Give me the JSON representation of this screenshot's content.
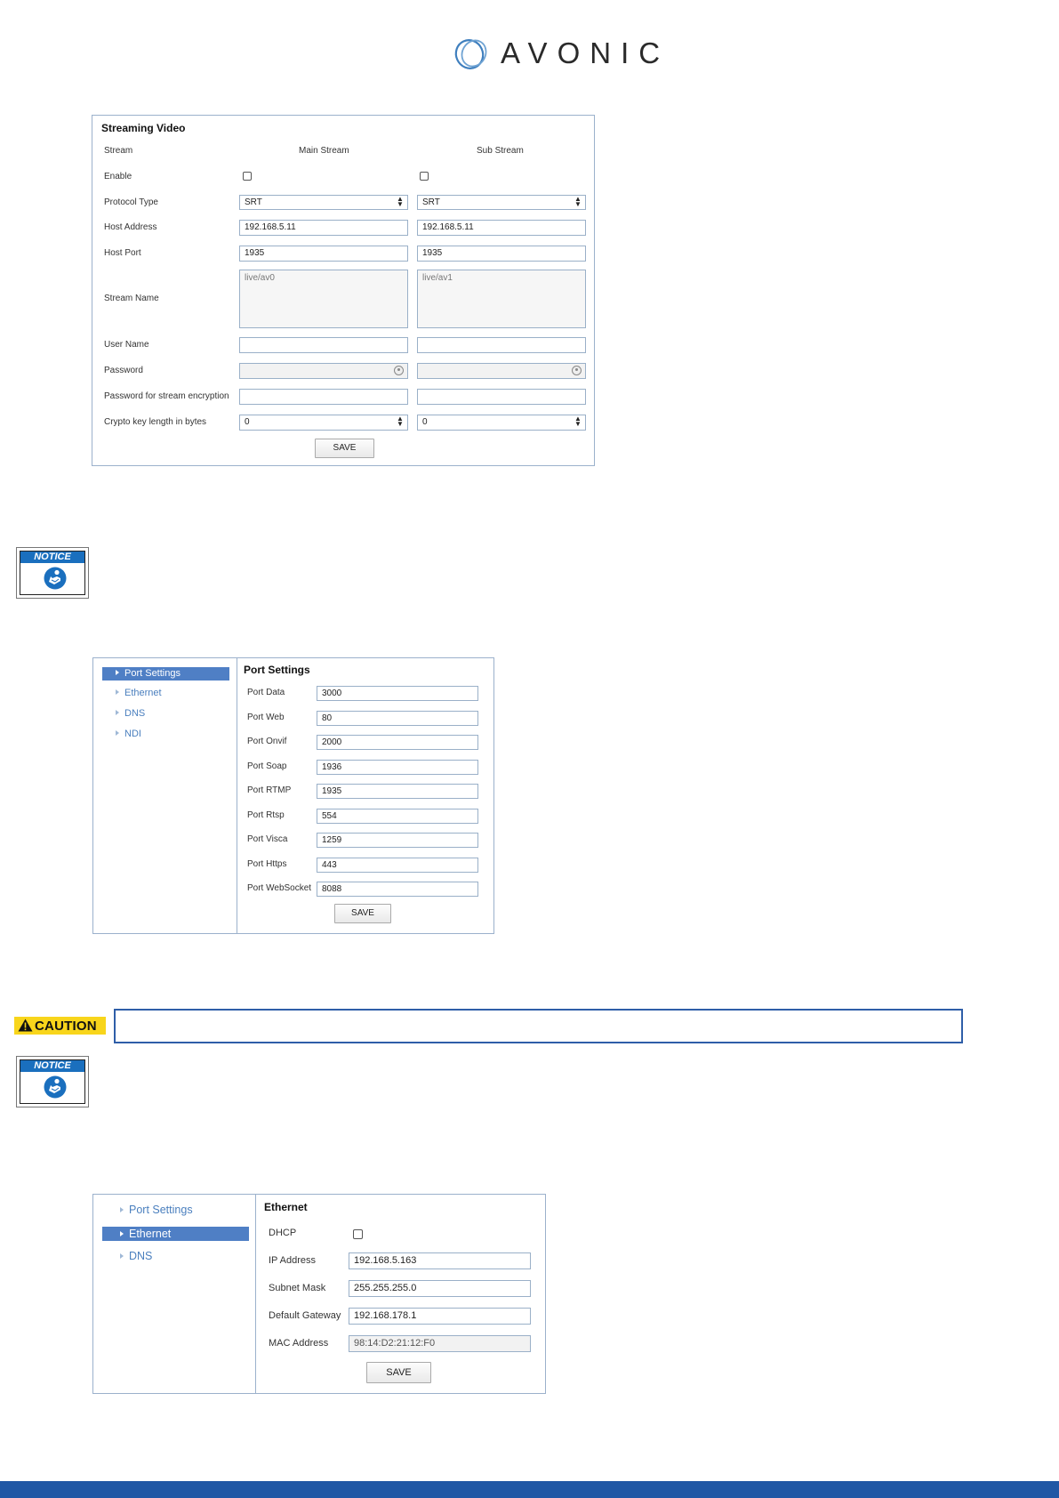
{
  "brand": {
    "name": "AVONIC",
    "color": "#2a2a2a",
    "accent": "#4a8ac5"
  },
  "streaming": {
    "title": "Streaming Video",
    "col_stream": "Stream",
    "col_main": "Main Stream",
    "col_sub": "Sub Stream",
    "enable_label": "Enable",
    "protocol_label": "Protocol Type",
    "host_address_label": "Host Address",
    "host_port_label": "Host Port",
    "stream_name_label": "Stream Name",
    "user_name_label": "User Name",
    "password_label": "Password",
    "password_enc_label": "Password for stream encryption",
    "crypto_label": "Crypto key length in bytes",
    "main": {
      "enabled": false,
      "protocol": "SRT",
      "host_address": "192.168.5.11",
      "host_port": "1935",
      "stream_name": "live/av0",
      "user_name": "",
      "password": "",
      "password_enc": "",
      "crypto": "0"
    },
    "sub": {
      "enabled": false,
      "protocol": "SRT",
      "host_address": "192.168.5.11",
      "host_port": "1935",
      "stream_name": "live/av1",
      "user_name": "",
      "password": "",
      "password_enc": "",
      "crypto": "0"
    },
    "save_label": "SAVE"
  },
  "notice_label": "NOTICE",
  "caution_label": "CAUTION",
  "port_settings": {
    "nav": [
      "Port Settings",
      "Ethernet",
      "DNS",
      "NDI"
    ],
    "title": "Port Settings",
    "rows": [
      {
        "label": "Port Data",
        "value": "3000"
      },
      {
        "label": "Port Web",
        "value": "80"
      },
      {
        "label": "Port Onvif",
        "value": "2000"
      },
      {
        "label": "Port Soap",
        "value": "1936"
      },
      {
        "label": "Port RTMP",
        "value": "1935"
      },
      {
        "label": "Port Rtsp",
        "value": "554"
      },
      {
        "label": "Port Visca",
        "value": "1259"
      },
      {
        "label": "Port Https",
        "value": "443"
      },
      {
        "label": "Port WebSocket",
        "value": "8088"
      }
    ],
    "save_label": "SAVE"
  },
  "ethernet": {
    "nav": [
      "Port Settings",
      "Ethernet",
      "DNS"
    ],
    "title": "Ethernet",
    "dhcp_label": "DHCP",
    "dhcp": false,
    "ip_label": "IP Address",
    "ip": "192.168.5.163",
    "subnet_label": "Subnet Mask",
    "subnet": "255.255.255.0",
    "gateway_label": "Default Gateway",
    "gateway": "192.168.178.1",
    "mac_label": "MAC Address",
    "mac": "98:14:D2:21:12:F0",
    "save_label": "SAVE"
  },
  "colors": {
    "nav_selected": "#4f7fc5",
    "footer": "#2057a5",
    "caution": "#f8d51b",
    "notice": "#1a6fbe"
  }
}
